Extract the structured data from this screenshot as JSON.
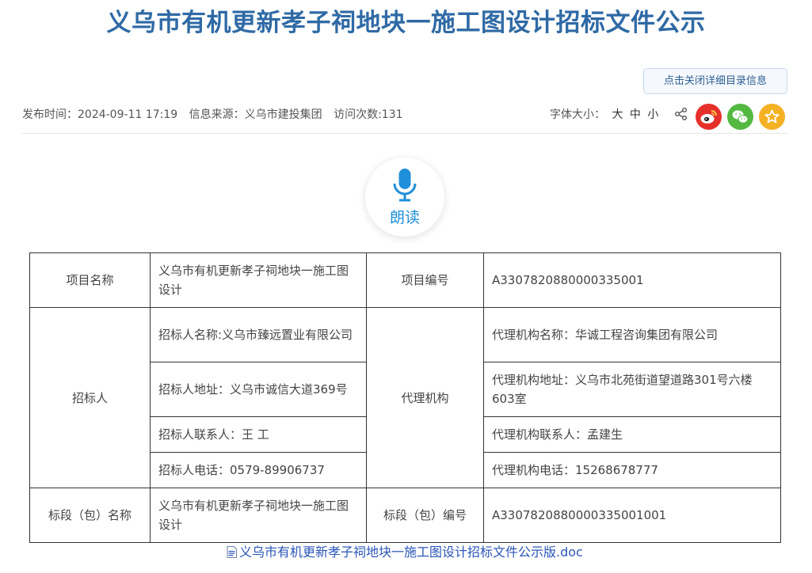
{
  "page": {
    "title": "义乌市有机更新孝子祠地块一施工图设计招标文件公示"
  },
  "toolbar": {
    "detail_button": "点击关闭详细目录信息"
  },
  "meta": {
    "publish_time": "发布时间：2024-09-11 17:19",
    "source": "信息来源：义乌市建投集团",
    "visits": "访问次数:131",
    "font_size_label": "字体大小：",
    "font_large": "大",
    "font_medium": "中",
    "font_small": "小"
  },
  "icons": {
    "share": "share-icon",
    "weibo": "weibo-icon",
    "wechat": "wechat-icon",
    "favorite": "star-icon",
    "read": "microphone-icon",
    "document": "doc-file-icon"
  },
  "colors": {
    "title": "#2f6aa5",
    "weibo": "#e6312a",
    "wechat": "#53b941",
    "favorite": "#f4b123",
    "read_accent": "#1f8fdb",
    "link": "#2b56b7"
  },
  "read": {
    "label": "朗读"
  },
  "table": {
    "project_name_label": "项目名称",
    "project_name": "义乌市有机更新孝子祠地块一施工图设计",
    "project_no_label": "项目编号",
    "project_no": "A3307820880000335001",
    "tenderer_label": "招标人",
    "tenderer_name": "招标人名称:义乌市臻远置业有限公司",
    "tenderer_address": "招标人地址：义乌市诚信大道369号",
    "tenderer_contact": "招标人联系人：王 工",
    "tenderer_phone": "招标人电话：0579-89906737",
    "agent_label": "代理机构",
    "agent_name": "代理机构名称：华诚工程咨询集团有限公司",
    "agent_address": "代理机构地址：义乌市北苑街道望道路301号六楼603室",
    "agent_contact": "代理机构联系人：孟建生",
    "agent_phone": "代理机构电话：15268678777",
    "section_name_label": "标段（包）名称",
    "section_name": "义乌市有机更新孝子祠地块一施工图设计",
    "section_no_label": "标段（包）编号",
    "section_no": "A3307820880000335001001"
  },
  "attachment": {
    "filename": "义乌市有机更新孝子祠地块一施工图设计招标文件公示版.doc"
  }
}
